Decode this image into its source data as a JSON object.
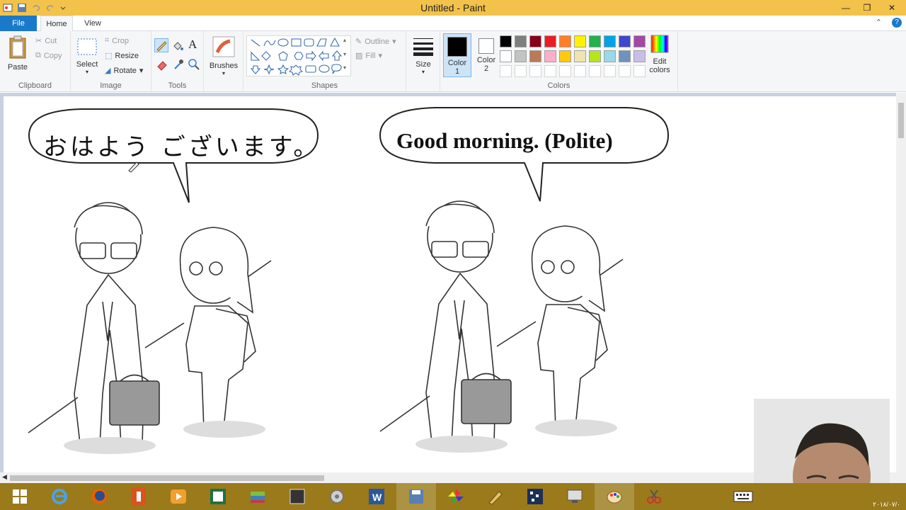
{
  "window": {
    "title": "Untitled - Paint",
    "minimize": "—",
    "maximize": "❐",
    "close": "✕"
  },
  "tabs": [
    {
      "label": "File"
    },
    {
      "label": "Home"
    },
    {
      "label": "View"
    }
  ],
  "ribbon": {
    "clipboard": {
      "label": "Clipboard",
      "paste": "Paste",
      "cut": "Cut",
      "copy": "Copy"
    },
    "image": {
      "label": "Image",
      "select": "Select",
      "crop": "Crop",
      "resize": "Resize",
      "rotate": "Rotate"
    },
    "tools": {
      "label": "Tools"
    },
    "brushes": {
      "label": "Brushes"
    },
    "shapes": {
      "label": "Shapes",
      "outline": "Outline",
      "fill": "Fill"
    },
    "size": {
      "label": "Size"
    },
    "colors": {
      "label": "Colors",
      "color1_a": "Color",
      "color1_b": "1",
      "color2_a": "Color",
      "color2_b": "2",
      "edit_a": "Edit",
      "edit_b": "colors",
      "color1": "#000000",
      "color2": "#ffffff"
    },
    "palette_row1": [
      "#000000",
      "#7f7f7f",
      "#880015",
      "#ed1c24",
      "#ff7f27",
      "#fff200",
      "#22b14c",
      "#00a2e8",
      "#3f48cc",
      "#a349a4"
    ],
    "palette_row2": [
      "#ffffff",
      "#c3c3c3",
      "#b97a57",
      "#ffaec9",
      "#ffc90e",
      "#efe4b0",
      "#b5e61d",
      "#99d9ea",
      "#7092be",
      "#c8bfe7"
    ]
  },
  "canvas": {
    "bubble_left": "おはよう ございます。",
    "bubble_right": "Good morning. (Polite)"
  },
  "taskbar": {
    "time": "۲۰۱۸/۰۷/۰"
  }
}
